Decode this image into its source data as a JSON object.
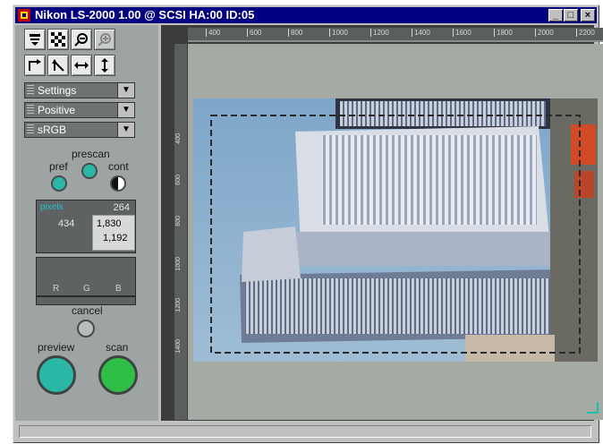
{
  "window": {
    "title": "Nikon LS-2000 1.00 @ SCSI HA:00 ID:05"
  },
  "titlebar_buttons": {
    "minimize": "_",
    "maximize": "□",
    "close": "×"
  },
  "toolbar": {
    "row1": [
      "film-holder-icon",
      "checker-icon",
      "zoom-out-icon",
      "zoom-in-icon"
    ],
    "row2": [
      "rotate-right-icon",
      "rotate-left-icon",
      "flip-horizontal-icon",
      "flip-vertical-icon"
    ]
  },
  "dropdowns": {
    "settings": "Settings",
    "mode": "Positive",
    "color_space": "sRGB"
  },
  "prescan": {
    "title": "prescan",
    "pref": "pref",
    "cont": "cont"
  },
  "info": {
    "unit": "pixels",
    "top_value": "264",
    "left_value": "434",
    "width": "1,830",
    "height": "1,192"
  },
  "histogram": {
    "r": "R",
    "g": "G",
    "b": "B"
  },
  "actions": {
    "cancel": "cancel",
    "preview": "preview",
    "scan": "scan"
  },
  "ruler": {
    "h_ticks": [
      "400",
      "600",
      "800",
      "1000",
      "1200",
      "1400",
      "1600",
      "1800",
      "2000",
      "2200"
    ],
    "v_ticks": [
      "400",
      "600",
      "800",
      "1000",
      "1200",
      "1400"
    ]
  },
  "colors": {
    "title_bar": "#000080",
    "panel": "#9ea3a3",
    "led_teal": "#2bb7a6",
    "scan_green": "#2fbf46",
    "canvas": "#a6aaa4"
  }
}
